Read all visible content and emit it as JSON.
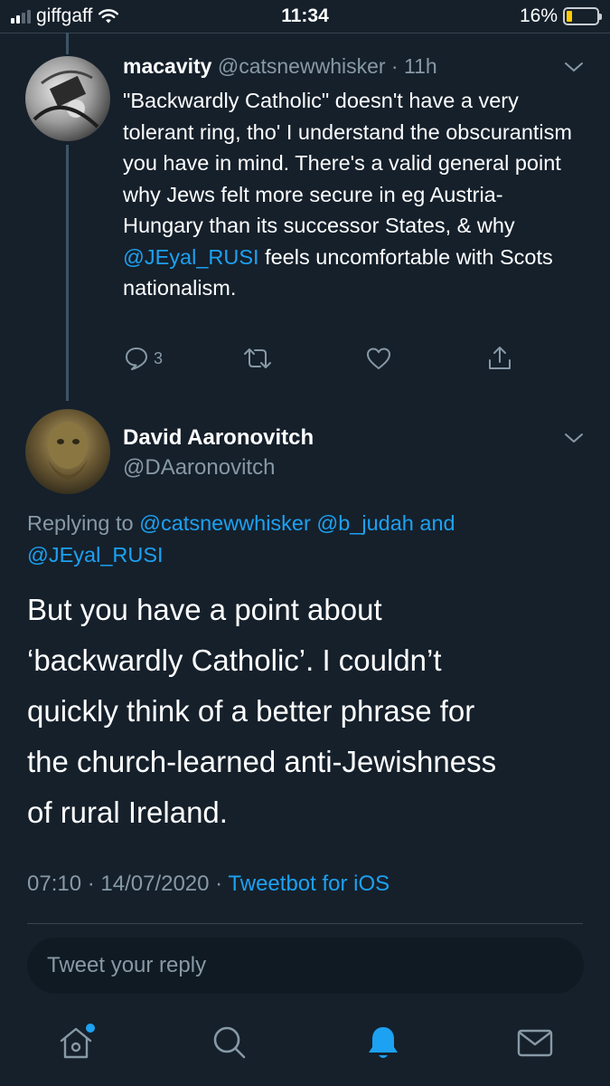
{
  "status_bar": {
    "carrier": "giffgaff",
    "time": "11:34",
    "battery": "16%"
  },
  "parent_tweet": {
    "name": "macavity",
    "handle": "@catsnewwhisker",
    "separator": " · ",
    "age": "11h",
    "body_before_mention": "\"Backwardly Catholic\" doesn't have a very tolerant ring, tho' I understand the obscurantism you have in mind. There's a valid general point why Jews felt more secure in eg Austria-Hungary than its successor States, & why ",
    "mention": "@JEyal_RUSI",
    "body_after_mention": " feels uncomfortable with Scots nationalism.",
    "reply_count": "3"
  },
  "main_tweet": {
    "name": "David Aaronovitch",
    "handle": "@DAaronovitch",
    "replying_prefix": "Replying to ",
    "replying_to": [
      "@catsnewwhisker",
      "@b_judah",
      "@JEyal_RUSI"
    ],
    "replying_and": " and ",
    "body": "But you have a point about\n‘backwardly Catholic’. I couldn’t\nquickly think of a better phrase for\nthe church-learned anti-Jewishness\nof rural Ireland.",
    "timestamp": "07:10 · 14/07/2020 · ",
    "via": "Tweetbot for iOS"
  },
  "reply_box": {
    "placeholder": "Tweet your reply"
  },
  "icons": {
    "reply": "reply-icon",
    "retweet": "retweet-icon",
    "like": "like-icon",
    "share": "share-icon",
    "home": "home-icon",
    "search": "search-icon",
    "notifications": "notifications-icon",
    "messages": "messages-icon"
  },
  "colors": {
    "background": "#15202b",
    "accent": "#1da1f2",
    "muted": "#8899a6"
  }
}
